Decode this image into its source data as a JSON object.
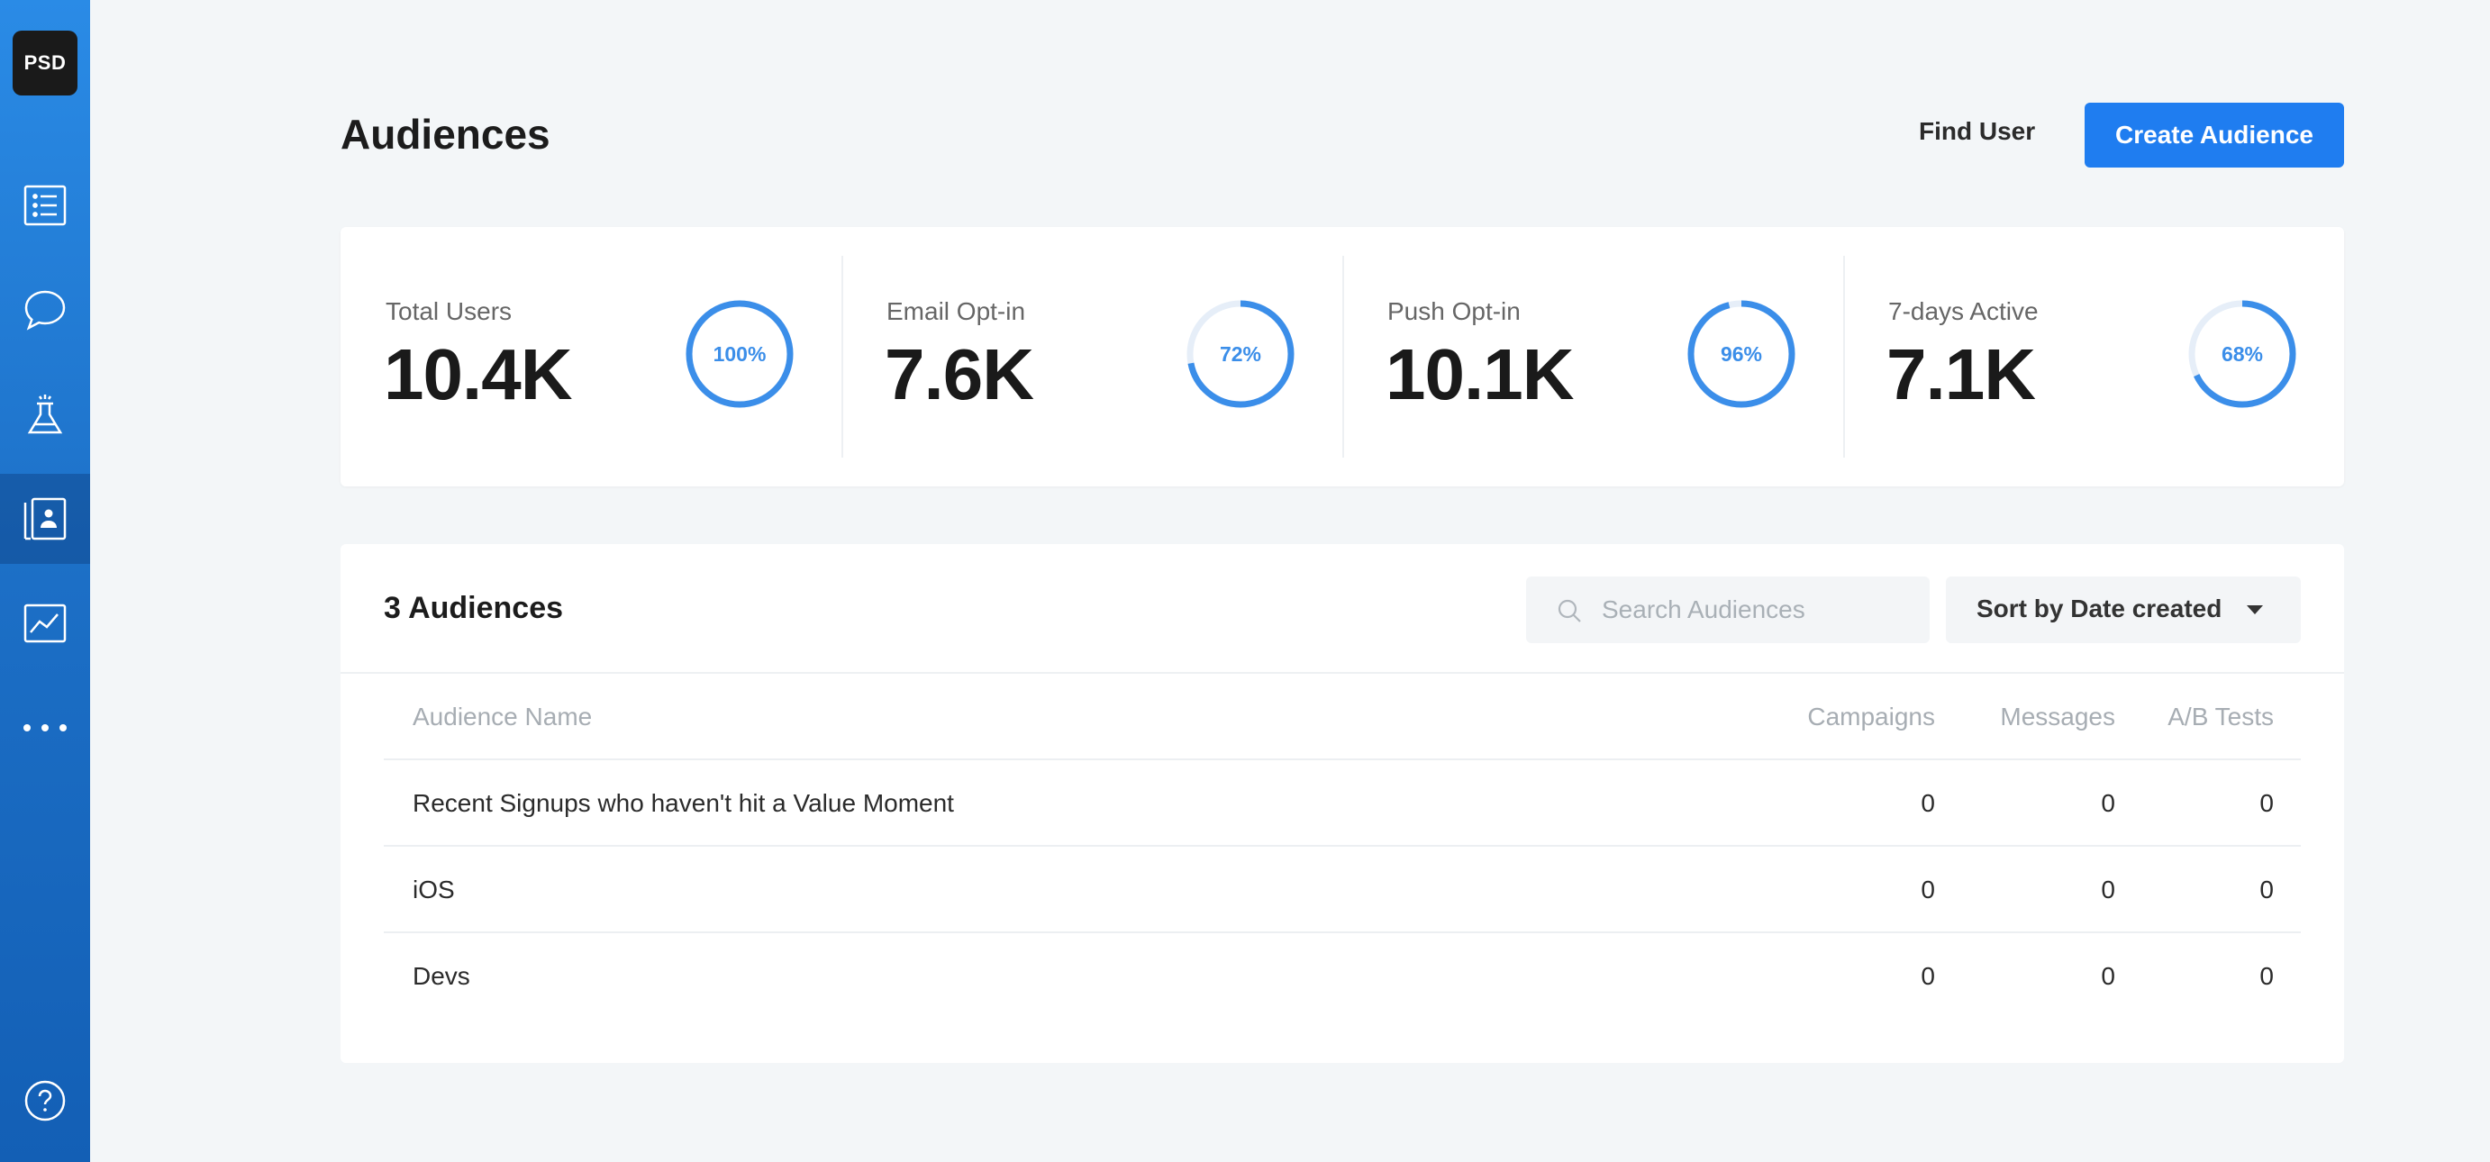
{
  "sidebar": {
    "logo": "PSD",
    "items": [
      {
        "name": "list"
      },
      {
        "name": "messages"
      },
      {
        "name": "experiments"
      },
      {
        "name": "audiences",
        "active": true
      },
      {
        "name": "analytics"
      },
      {
        "name": "more"
      }
    ],
    "help_icon": "help-icon"
  },
  "header": {
    "title": "Audiences",
    "find_user": "Find User",
    "create_button": "Create Audience"
  },
  "stats": [
    {
      "label": "Total Users",
      "value": "10.4K",
      "percent_label": "100%",
      "percent": 100
    },
    {
      "label": "Email Opt-in",
      "value": "7.6K",
      "percent_label": "72%",
      "percent": 72
    },
    {
      "label": "Push Opt-in",
      "value": "10.1K",
      "percent_label": "96%",
      "percent": 96
    },
    {
      "label": "7-days Active",
      "value": "7.1K",
      "percent_label": "68%",
      "percent": 68
    }
  ],
  "audiences": {
    "count_title": "3 Audiences",
    "search_placeholder": "Search Audiences",
    "sort_label": "Sort by Date created",
    "columns": [
      "Audience Name",
      "Campaigns",
      "Messages",
      "A/B Tests"
    ],
    "rows": [
      {
        "name": "Recent Signups who haven't hit a Value Moment",
        "campaigns": "0",
        "messages": "0",
        "ab_tests": "0"
      },
      {
        "name": "iOS",
        "campaigns": "0",
        "messages": "0",
        "ab_tests": "0"
      },
      {
        "name": "Devs",
        "campaigns": "0",
        "messages": "0",
        "ab_tests": "0"
      }
    ]
  },
  "colors": {
    "accent": "#1f7df0",
    "ring": "#3b8ee9",
    "ring_track": "#e6eef8"
  }
}
